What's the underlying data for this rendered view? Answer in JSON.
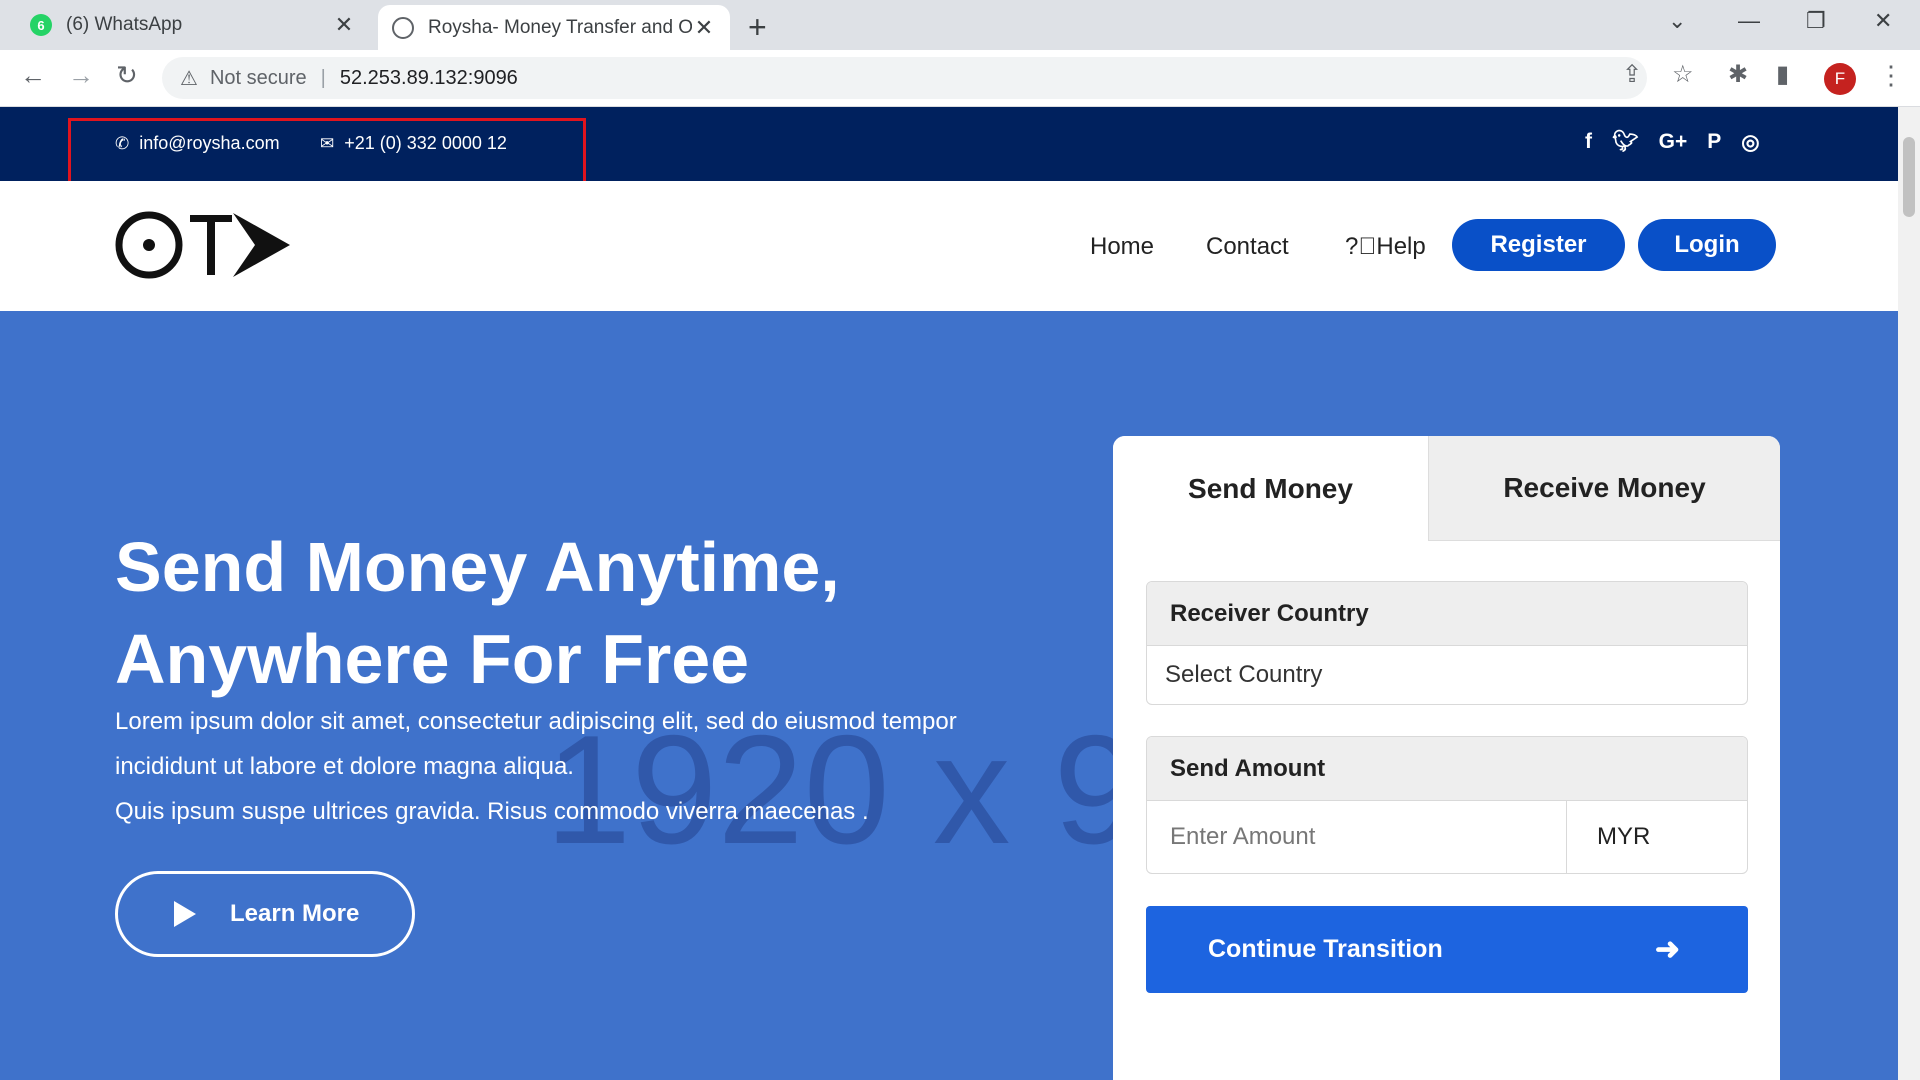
{
  "browser": {
    "tabs": [
      {
        "title": "(6) WhatsApp",
        "badge": "6",
        "active": false
      },
      {
        "title": "Roysha- Money Transfer and Onl",
        "active": true
      }
    ],
    "security_label": "Not secure",
    "url": "52.253.89.132:9096",
    "profile_initial": "F"
  },
  "topbar": {
    "email": "info@roysha.com",
    "phone": "+21 (0) 332 0000 12",
    "socials": [
      "facebook",
      "twitter",
      "google-plus",
      "pinterest",
      "instagram"
    ],
    "highlight_color": "#e0141e",
    "background": "#00215e"
  },
  "header": {
    "logo_text": "OT",
    "menu": {
      "home": "Home",
      "contact": "Contact",
      "help": "Help"
    },
    "register_label": "Register",
    "login_label": "Login"
  },
  "hero": {
    "title_line1": "Send Money Anytime,",
    "title_line2": "Anywhere For Free",
    "text_line1": "Lorem ipsum dolor sit amet, consectetur adipiscing elit, sed do eiusmod tempor",
    "text_line2": "incididunt ut labore et dolore magna aliqua.",
    "text_line3": "Quis ipsum suspe ultrices gravida. Risus commodo viverra maecenas .",
    "learn_more_label": "Learn More",
    "watermark": "1920 x 9",
    "background": "#3f72cb"
  },
  "transfer_card": {
    "tab_send": "Send Money",
    "tab_receive": "Receive Money",
    "receiver_country_label": "Receiver Country",
    "receiver_country_value": "Select Country",
    "send_amount_label": "Send Amount",
    "amount_placeholder": "Enter Amount",
    "currency": "MYR",
    "continue_label": "Continue Transition",
    "button_color": "#1d64e0"
  }
}
